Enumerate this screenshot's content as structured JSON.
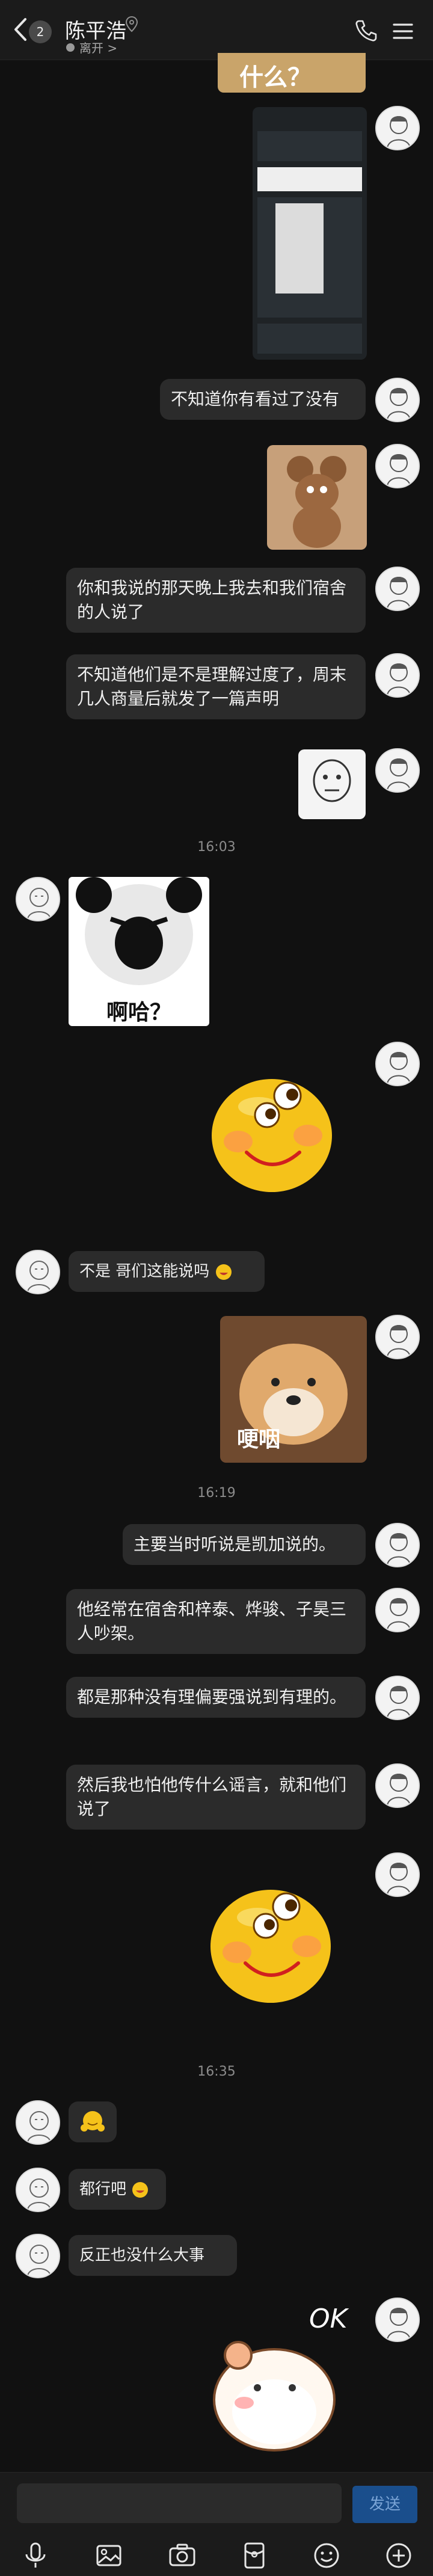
{
  "header": {
    "unread_count": "2",
    "contact_name": "陈平浩",
    "status_text": "离开 >"
  },
  "messages": {
    "m1_text": "不知道你有看过了没有",
    "m2_text": "你和我说的那天晚上我去和我们宿舍的人说了",
    "m3_text": "不知道他们是不是理解过度了，周末几人商量后就发了一篇声明",
    "ts1": "16:03",
    "sticker_haha_caption": "啊哈？",
    "m4_text": "不是 哥们这能说吗",
    "sticker_dog_caption": "哽咽",
    "ts2": "16:19",
    "m5_text": "主要当时听说是凯加说的。",
    "m6_text": "他经常在宿舍和梓泰、烨骏、子昊三人吵架。",
    "m7_text": "都是那种没有理偏要强说到有理的。",
    "m8_text": "然后我也怕他传什么谣言，就和他们说了",
    "ts3": "16:35",
    "m9_text": "都行吧",
    "m10_text": "反正也没什么大事",
    "sticker_ok_caption": "OK",
    "sticker_top_caption": "什么？"
  },
  "composer": {
    "send_label": "发送"
  },
  "colors": {
    "background": "#111111",
    "bubble": "#2b2b2b",
    "send_button": "#1a4e8c"
  },
  "icons": [
    "back-arrow-icon",
    "location-pin-icon",
    "phone-icon",
    "menu-icon",
    "microphone-icon",
    "image-icon",
    "camera-icon",
    "red-packet-icon",
    "emoji-icon",
    "plus-icon"
  ]
}
